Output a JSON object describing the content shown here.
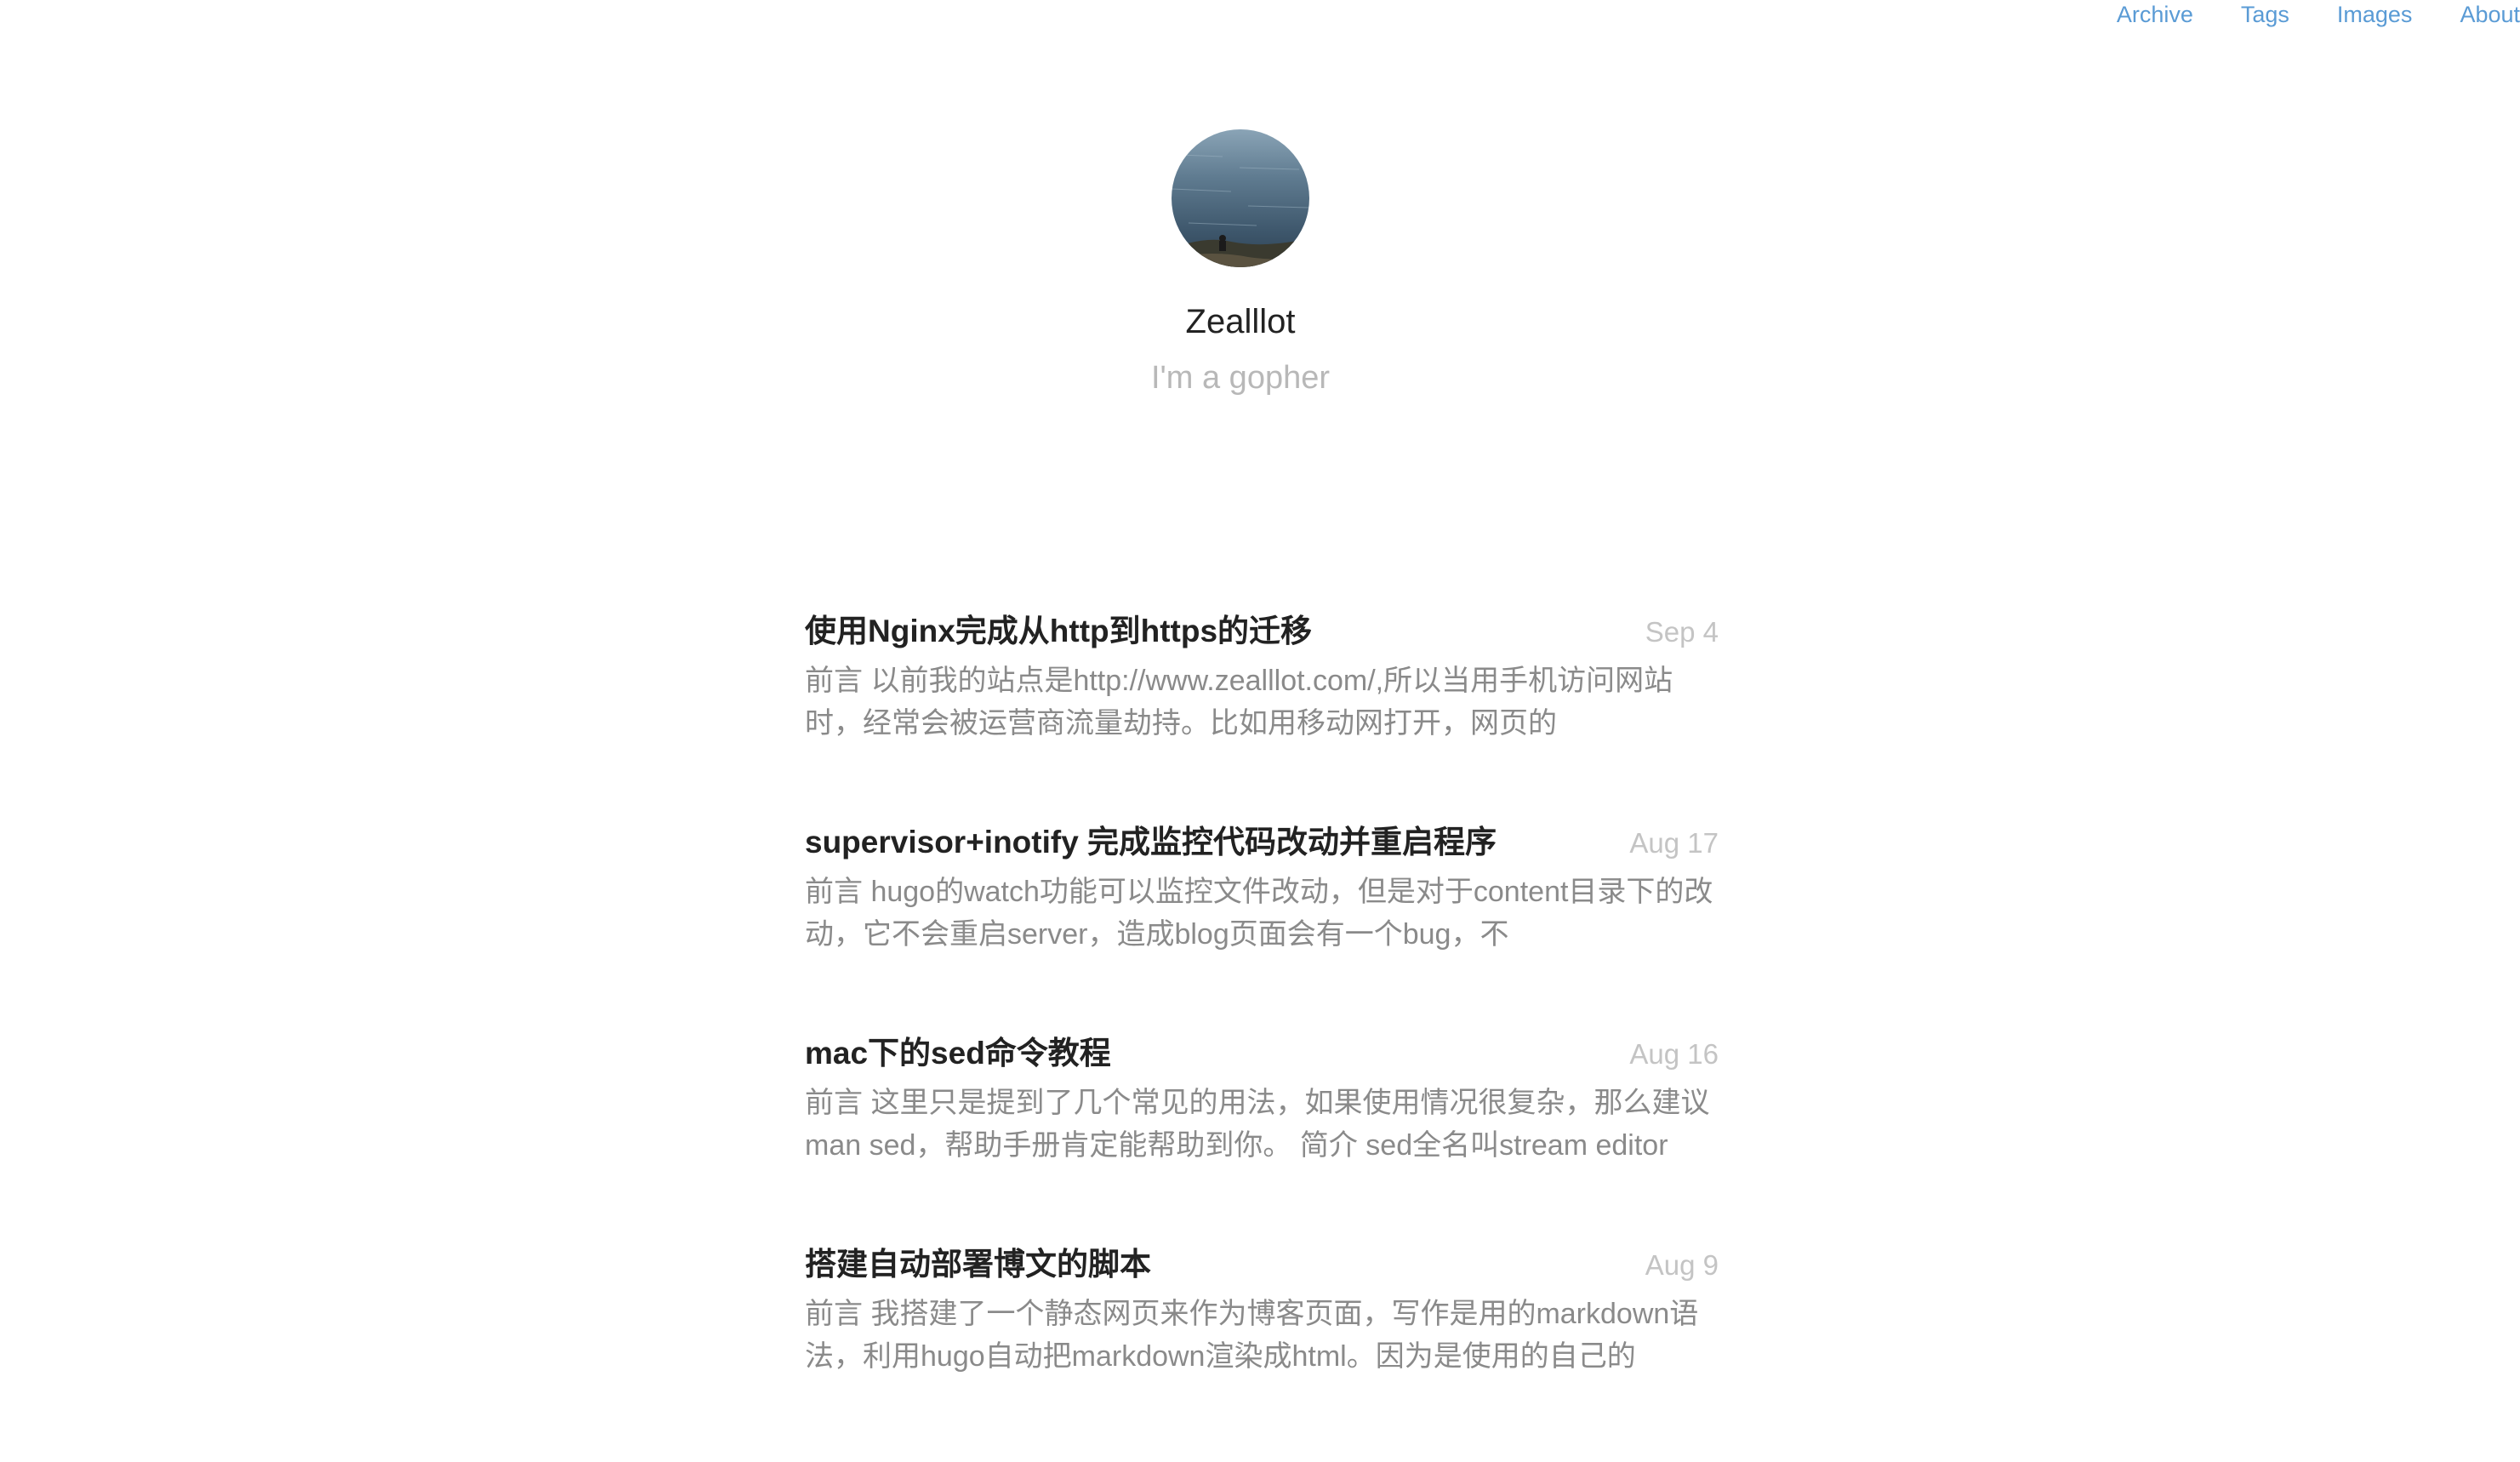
{
  "nav": {
    "items": [
      "Archive",
      "Tags",
      "Images",
      "About"
    ]
  },
  "profile": {
    "name": "Zealllot",
    "bio": "I'm a gopher"
  },
  "posts": [
    {
      "title": "使用Nginx完成从http到https的迁移",
      "date": "Sep 4",
      "summary": "前言 以前我的站点是http://www.zealllot.com/,所以当用手机访问网站时，经常会被运营商流量劫持。比如用移动网打开，网页的"
    },
    {
      "title": "supervisor+inotify 完成监控代码改动并重启程序",
      "date": "Aug 17",
      "summary": "前言 hugo的watch功能可以监控文件改动，但是对于content目录下的改动，它不会重启server，造成blog页面会有一个bug，不"
    },
    {
      "title": "mac下的sed命令教程",
      "date": "Aug 16",
      "summary": "前言 这里只是提到了几个常见的用法，如果使用情况很复杂，那么建议man sed，帮助手册肯定能帮助到你。 简介 sed全名叫stream editor"
    },
    {
      "title": "搭建自动部署博文的脚本",
      "date": "Aug 9",
      "summary": "前言 我搭建了一个静态网页来作为博客页面，写作是用的markdown语法，利用hugo自动把markdown渲染成html。因为是使用的自己的"
    }
  ],
  "colors": {
    "link": "#5a9bd5",
    "title": "#222222",
    "summary": "#8a8a8a",
    "date": "#c4c4c4",
    "bio": "#b8b8b8"
  }
}
